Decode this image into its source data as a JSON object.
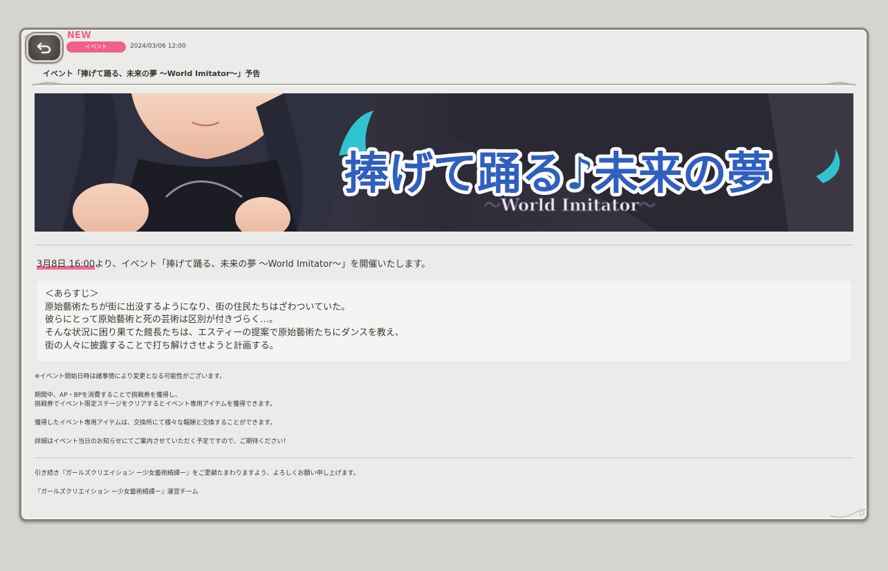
{
  "header": {
    "new_label": "NEW",
    "category": "イベント",
    "date": "2024/03/06 12:00",
    "title": "イベント「捧げて踊る、未来の夢 〜World Imitator〜」予告"
  },
  "banner": {
    "logo_text": "捧げて踊る♪未来の夢",
    "logo_subtext": "〜World Imitator〜"
  },
  "intro": {
    "highlight": "3月8日 16:00",
    "rest": "より、イベント「捧げて踊る、未来の夢 〜World Imitator〜」を開催いたします。"
  },
  "synopsis": {
    "lines": [
      "＜あらすじ＞",
      "原始藝術たちが街に出没するようになり、街の住民たちはざわついていた。",
      "彼らにとって原始藝術と死の芸術は区別が付きづらく…。",
      "そんな状況に困り果てた館長たちは、エスティーの提案で原始藝術たちにダンスを教え、",
      "街の人々に披露することで打ち解けさせようと計画する。"
    ]
  },
  "notes": {
    "note1": "※イベント開始日時は諸事情により変更となる可能性がございます。",
    "note2a": "期間中、AP・BPを消費することで挑戦券を獲得し、",
    "note2b": "挑戦券でイベント限定ステージをクリアするとイベント専用アイテムを獲得できます。",
    "note3": "獲得したイベント専用アイテムは、交換所にて様々な報酬と交換することができます。",
    "note4": "詳細はイベント当日のお知らせにてご案内させていただく予定ですので、ご期待ください！"
  },
  "footer": {
    "thanks": "引き続き『ガールズクリエイション ー少女藝術綺譚ー』をご愛顧たまわりますよう、よろしくお願い申し上げます。",
    "team": "『ガールズクリエイション ー少女藝術綺譚ー』運営チーム"
  },
  "colors": {
    "accent_pink": "#f0608a",
    "panel_bg": "#ebebea",
    "page_bg": "#d6d5d0"
  },
  "icons": {
    "back": "back-arrow-icon"
  }
}
